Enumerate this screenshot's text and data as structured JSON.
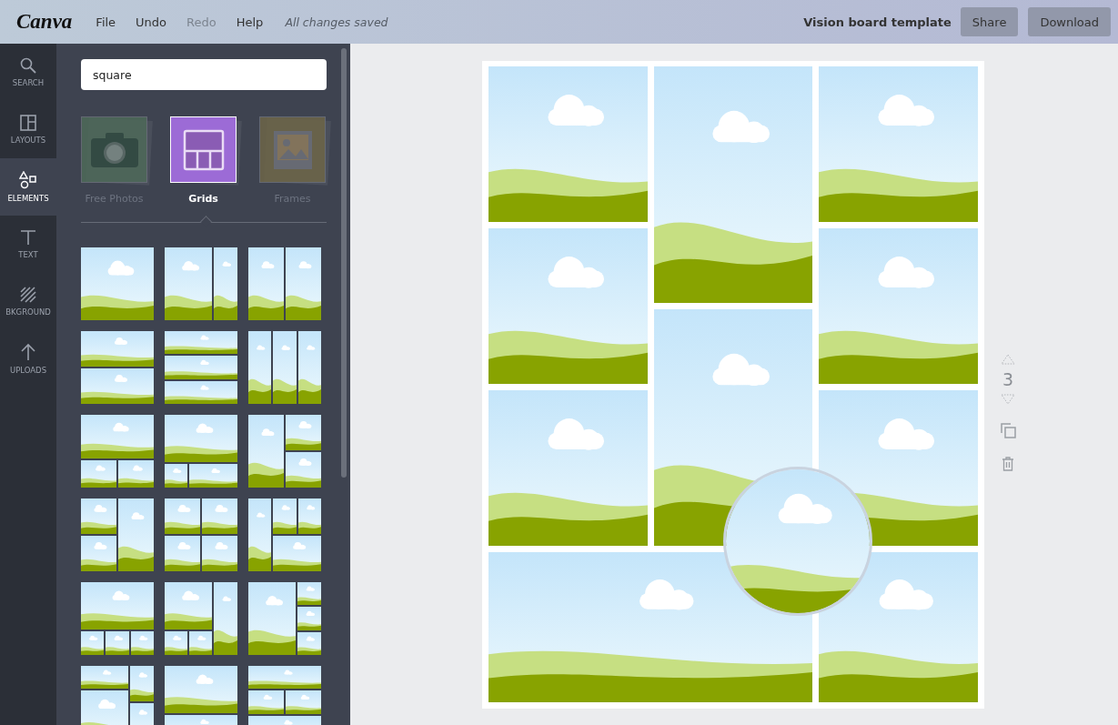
{
  "topbar": {
    "logo": "Canva",
    "menu": [
      {
        "label": "File",
        "disabled": false
      },
      {
        "label": "Undo",
        "disabled": false
      },
      {
        "label": "Redo",
        "disabled": true
      },
      {
        "label": "Help",
        "disabled": false
      }
    ],
    "save_status": "All changes saved",
    "document_title": "Vision board template",
    "buttons": [
      "Share",
      "Download"
    ]
  },
  "rail": [
    {
      "label": "SEARCH",
      "kind": "search",
      "selected": false
    },
    {
      "label": "LAYOUTS",
      "kind": "layouts",
      "selected": false
    },
    {
      "label": "ELEMENTS",
      "kind": "elements",
      "selected": true
    },
    {
      "label": "TEXT",
      "kind": "text",
      "selected": false
    },
    {
      "label": "BKGROUND",
      "kind": "background",
      "selected": false
    },
    {
      "label": "UPLOADS",
      "kind": "uploads",
      "selected": false
    }
  ],
  "panel": {
    "search": {
      "value": "square"
    },
    "categories": [
      {
        "label": "Free Photos",
        "kind": "camera",
        "selected": false
      },
      {
        "label": "Grids",
        "kind": "grid",
        "selected": true
      },
      {
        "label": "Frames",
        "kind": "frame",
        "selected": false
      }
    ]
  },
  "page_tools": {
    "page_number": "3"
  }
}
